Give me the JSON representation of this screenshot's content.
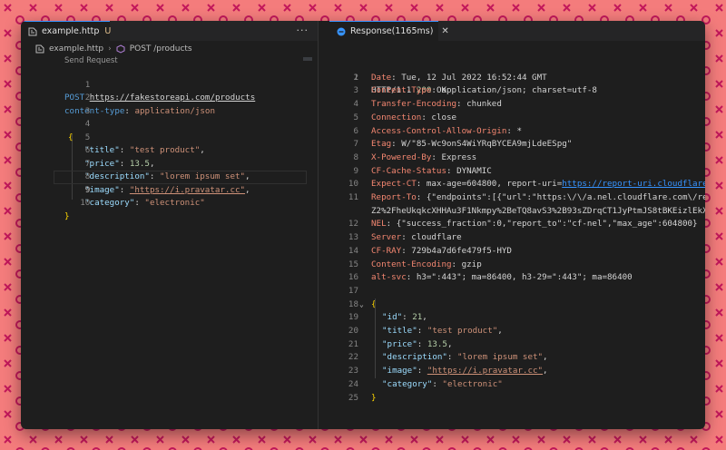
{
  "left_tab": {
    "title": "example.http",
    "status": "U"
  },
  "left_actions": "···",
  "breadcrumb": {
    "file": "example.http",
    "symbol": "POST /products"
  },
  "codelens": "Send Request",
  "request": {
    "method": "POST",
    "url": "https://fakestoreapi.com/products",
    "header_name": "content-type",
    "header_value": "application/json",
    "lines": [
      {
        "n": "1"
      },
      {
        "n": "2"
      },
      {
        "n": "3"
      },
      {
        "n": "4"
      },
      {
        "n": "5"
      },
      {
        "n": "6"
      },
      {
        "n": "7"
      },
      {
        "n": "8"
      },
      {
        "n": "9"
      },
      {
        "n": "10"
      }
    ],
    "body": {
      "open": "{",
      "title_key": "\"title\"",
      "title_val": "\"test product\"",
      "price_key": "\"price\"",
      "price_val": "13.5",
      "desc_key": "\"description\"",
      "desc_val": "\"lorem ipsum set\"",
      "image_key": "\"image\"",
      "image_val": "\"https://i.pravatar.cc\"",
      "category_key": "\"category\"",
      "category_val": "\"electronic\"",
      "close": "}"
    }
  },
  "right_tab": {
    "title": "Response(1165ms)"
  },
  "response": {
    "status_line": {
      "proto": "HTTP/1.1",
      "code": "200",
      "text": "OK"
    },
    "headers": [
      {
        "n": "2",
        "k": "Date",
        "v": "Tue, 12 Jul 2022 16:52:44 GMT"
      },
      {
        "n": "3",
        "k": "Content-Type",
        "v": "application/json; charset=utf-8"
      },
      {
        "n": "4",
        "k": "Transfer-Encoding",
        "v": "chunked"
      },
      {
        "n": "5",
        "k": "Connection",
        "v": "close"
      },
      {
        "n": "6",
        "k": "Access-Control-Allow-Origin",
        "v": "*"
      },
      {
        "n": "7",
        "k": "Etag",
        "v": "W/\"85-Wc9onS4WiYRqBYCEA9mjLdeESpg\""
      },
      {
        "n": "8",
        "k": "X-Powered-By",
        "v": "Express"
      },
      {
        "n": "9",
        "k": "CF-Cache-Status",
        "v": "DYNAMIC"
      },
      {
        "n": "10",
        "k": "Expect-CT",
        "v": "max-age=604800, report-uri=",
        "link": "https://report-uri.cloudflare"
      },
      {
        "n": "11",
        "k": "Report-To",
        "v": "{\"endpoints\":[{\"url\":\"https:\\/\\/a.nel.cloudflare.com\\/rep"
      },
      {
        "n": "",
        "k": "",
        "v": "Z2%2FheUkqkcXHHAu3F1Nkmpy%2BeTQ8avS3%2B93sZDrqCT1JyPtmJS8tBKEizlEkXV"
      },
      {
        "n": "12",
        "k": "NEL",
        "v": "{\"success_fraction\":0,\"report_to\":\"cf-nel\",\"max_age\":604800}"
      },
      {
        "n": "13",
        "k": "Server",
        "v": "cloudflare"
      },
      {
        "n": "14",
        "k": "CF-RAY",
        "v": "729b4a7d6fe479f5-HYD"
      },
      {
        "n": "15",
        "k": "Content-Encoding",
        "v": "gzip"
      },
      {
        "n": "16",
        "k": "alt-svc",
        "v": "h3=\":443\"; ma=86400, h3-29=\":443\"; ma=86400"
      }
    ],
    "body": {
      "open": "{",
      "id_key": "\"id\"",
      "id_val": "21",
      "title_key": "\"title\"",
      "title_val": "\"test product\"",
      "price_key": "\"price\"",
      "price_val": "13.5",
      "desc_key": "\"description\"",
      "desc_val": "\"lorem ipsum set\"",
      "image_key": "\"image\"",
      "image_val": "\"https://i.pravatar.cc\"",
      "category_key": "\"category\"",
      "category_val": "\"electronic\"",
      "close": "}"
    },
    "body_line_numbers": [
      "17",
      "18",
      "19",
      "20",
      "21",
      "22",
      "23",
      "24",
      "25",
      "26"
    ]
  },
  "colors": {
    "background": "#f47c7c",
    "pattern": "#c2185b",
    "accent": "#3794ff"
  }
}
